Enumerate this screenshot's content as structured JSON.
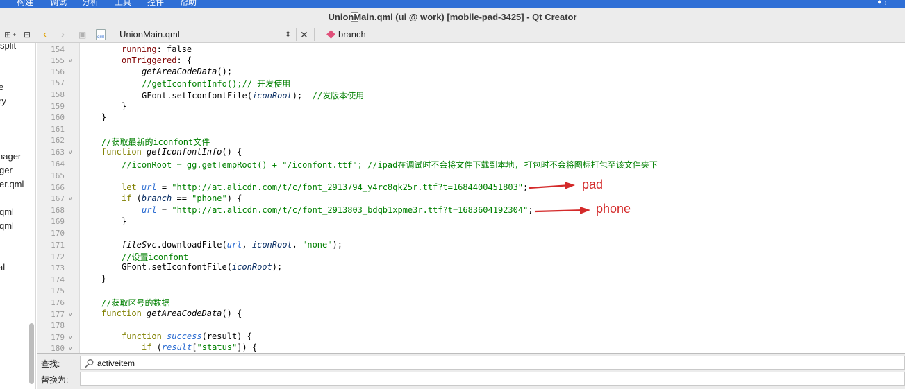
{
  "menubar": {
    "items": [
      "构建",
      "调试",
      "分析",
      "工具",
      "控件",
      "帮助"
    ]
  },
  "window": {
    "title": "UnionMain.qml (ui @ work) [mobile-pad-3425] - Qt Creator"
  },
  "toolbar": {
    "file_name": "UnionMain.qml",
    "branch_label": "branch"
  },
  "sidebar": {
    "items": [
      "split",
      "e",
      "ry",
      "nager",
      "ger",
      "er.qml",
      "l",
      "qml",
      "qml",
      "l",
      "al"
    ]
  },
  "editor": {
    "line_numbers": [
      "154",
      "155",
      "156",
      "157",
      "158",
      "159",
      "160",
      "161",
      "162",
      "163",
      "164",
      "165",
      "166",
      "167",
      "168",
      "169",
      "170",
      "171",
      "172",
      "173",
      "174",
      "175",
      "176",
      "177",
      "178",
      "179",
      "180"
    ],
    "folds": {
      "155": "v",
      "163": "v",
      "167": "v",
      "177": "v",
      "179": "v",
      "180": "v"
    },
    "lines": {
      "l154": {
        "a": "running",
        "b": ": false"
      },
      "l155": {
        "a": "onTriggered",
        "b": ": {"
      },
      "l156": {
        "a": "getAreaCodeData",
        "b": "();"
      },
      "l157": {
        "a": "//getIconfontInfo();// 开发使用"
      },
      "l158": {
        "a": "GFont.setIconfontFile(",
        "b": "iconRoot",
        "c": ");  ",
        "d": "//发版本使用"
      },
      "l159": {
        "a": "}"
      },
      "l160": {
        "a": "}"
      },
      "l162": {
        "a": "//获取最新的iconfont文件"
      },
      "l163": {
        "a": "function",
        "b": "getIconfontInfo",
        "c": "() {"
      },
      "l164": {
        "a": "//iconRoot = gg.getTempRoot() + \"/iconfont.ttf\"; //ipad在调试时不会将文件下载到本地, 打包时不会将图标打包至该文件夹下"
      },
      "l166": {
        "a": "let",
        "b": "url",
        "c": " = ",
        "d": "\"http://at.alicdn.com/t/c/font_2913794_y4rc8qk25r.ttf?t=1684400451803\"",
        "e": ";"
      },
      "l167": {
        "a": "if",
        "b": " (",
        "c": "branch",
        "d": " == ",
        "e": "\"phone\"",
        "f": ") {"
      },
      "l168": {
        "a": "url",
        "b": " = ",
        "c": "\"http://at.alicdn.com/t/c/font_2913803_bdqb1xpme3r.ttf?t=1683604192304\"",
        "d": ";"
      },
      "l169": {
        "a": "}"
      },
      "l171": {
        "a": "fileSvc",
        "b": ".downloadFile(",
        "c": "url",
        "d": ", ",
        "e": "iconRoot",
        "f": ", ",
        "g": "\"none\"",
        "h": ");"
      },
      "l172": {
        "a": "//设置iconfont"
      },
      "l173": {
        "a": "GFont.setIconfontFile(",
        "b": "iconRoot",
        "c": ");"
      },
      "l174": {
        "a": "}"
      },
      "l176": {
        "a": "//获取区号的数据"
      },
      "l177": {
        "a": "function",
        "b": "getAreaCodeData",
        "c": "() {"
      },
      "l179": {
        "a": "function",
        "b": "success",
        "c": "(result) {"
      },
      "l180": {
        "a": "if",
        "b": " (",
        "c": "result",
        "d": "[",
        "e": "\"status\"",
        "f": "]) {"
      }
    }
  },
  "annotations": {
    "pad": "pad",
    "phone": "phone",
    "color": "#d42a2a"
  },
  "findbar": {
    "find_label": "查找:",
    "find_value": "activeitem",
    "replace_label": "替换为:",
    "replace_value": ""
  }
}
